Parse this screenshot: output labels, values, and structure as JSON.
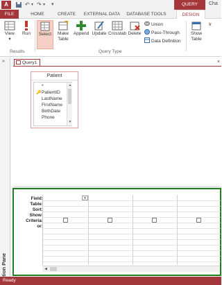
{
  "app": {
    "logo": "A",
    "contextual_group": "QUERY TOOLS",
    "window_title_fragment": "Cha"
  },
  "quick_access": {
    "save_icon": "save-icon",
    "undo_icon": "undo-icon",
    "redo_icon": "redo-icon",
    "customize_icon": "customize-icon"
  },
  "tabs": {
    "file": "FILE",
    "home": "HOME",
    "create": "CREATE",
    "external_data": "EXTERNAL DATA",
    "database_tools": "DATABASE TOOLS",
    "design": "DESIGN"
  },
  "ribbon": {
    "view": "View",
    "run": "Run",
    "select": "Select",
    "make_table": "Make",
    "make_table_2": "Table",
    "append": "Append",
    "update": "Update",
    "crosstab": "Crosstab",
    "delete": "Delete",
    "union": "Union",
    "pass_through": "Pass-Through",
    "data_definition": "Data Definition",
    "show_table": "Show",
    "show_table_2": "Table",
    "right_fragment": "Ir",
    "group_results": "Results",
    "group_query_type": "Query Type",
    "selected_button": "Select"
  },
  "navigation_pane": {
    "label": "Navigation Pane",
    "toggle": "»"
  },
  "document": {
    "tab_label": "Query1",
    "close": "×"
  },
  "table": {
    "name": "Patient",
    "fields": [
      "*",
      "PatientID",
      "LastName",
      "FirstName",
      "BirthDate",
      "Phone"
    ],
    "primary_key": "PatientID"
  },
  "grid": {
    "row_labels": [
      "Field:",
      "Table:",
      "Sort:",
      "Show:",
      "Criteria:",
      "or:"
    ],
    "columns": 4,
    "show_checked": [
      false,
      false,
      false,
      false
    ]
  },
  "status": {
    "text": "Ready"
  },
  "colors": {
    "accent": "#a4373a",
    "highlight": "#1f7f1f",
    "select_bg": "#f6d0c7"
  }
}
